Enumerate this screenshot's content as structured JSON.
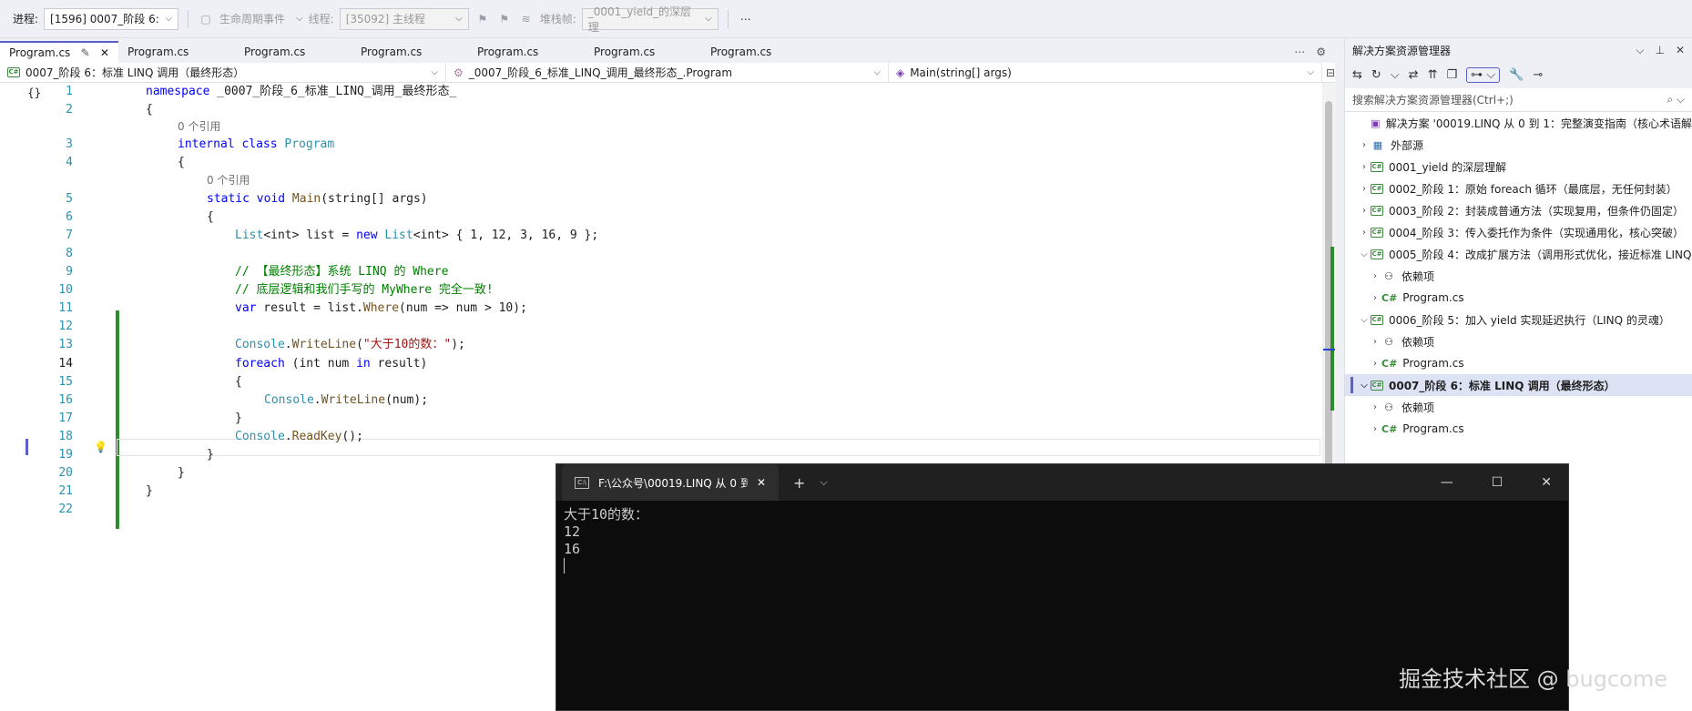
{
  "toolbar": {
    "process_label": "进程:",
    "process_value": "[1596] 0007_阶段 6:",
    "lifecycle_label": "生命周期事件",
    "thread_label": "线程:",
    "thread_value": "[35092] 主线程",
    "stackframe_label": "堆栈帧:",
    "stackframe_value": "_0001_yield_的深层理"
  },
  "tabs": [
    {
      "label": "Program.cs"
    },
    {
      "label": "Program.cs"
    },
    {
      "label": "Program.cs"
    },
    {
      "label": "Program.cs"
    },
    {
      "label": "Program.cs"
    },
    {
      "label": "Program.cs"
    },
    {
      "label": "Program.cs"
    }
  ],
  "navbar": {
    "project": "0007_阶段 6：标准 LINQ 调用（最终形态）",
    "type": "_0007_阶段_6_标准_LINQ_调用_最终形态_.Program",
    "member": "Main(string[] args)"
  },
  "code": {
    "l1_kw": "namespace",
    "l1_name": " _0007_阶段_6_标准_LINQ_调用_最终形态_",
    "l2": "{",
    "ref0": "0 个引用",
    "l3_kw": "internal class",
    "l3_ty": " Program",
    "l4": "{",
    "ref1": "0 个引用",
    "l5_kw": "static void",
    "l5_m": " Main",
    "l5_rest": "(string[] args)",
    "l6": "{",
    "l7_ty": "List",
    "l7_a": "<int> list = ",
    "l7_kw": "new",
    "l7_ty2": " List",
    "l7_b": "<int> { 1, 12, 3, 16, 9 };",
    "l9": "// 【最终形态】系统 LINQ 的 Where",
    "l10": "// 底层逻辑和我们手写的 MyWhere 完全一致!",
    "l11_kw": "var",
    "l11_a": " result = list.",
    "l11_m": "Where",
    "l11_b": "(num => num > 10);",
    "l13_ty": "Console",
    "l13_a": ".",
    "l13_m": "WriteLine",
    "l13_b": "(",
    "l13_str": "\"大于10的数：\"",
    "l13_c": ");",
    "l14_kw": "foreach",
    "l14_a": " (int num ",
    "l14_kw2": "in",
    "l14_b": " result)",
    "l15": "{",
    "l16_ty": "Console",
    "l16_a": ".",
    "l16_m": "WriteLine",
    "l16_b": "(num);",
    "l17": "}",
    "l18_ty": "Console",
    "l18_a": ".",
    "l18_m": "ReadKey",
    "l18_b": "();",
    "l19": "}",
    "l20": "}",
    "l21": "}"
  },
  "line_numbers": [
    "1",
    "2",
    "3",
    "4",
    "5",
    "6",
    "7",
    "8",
    "9",
    "10",
    "11",
    "12",
    "13",
    "14",
    "15",
    "16",
    "17",
    "18",
    "19",
    "20",
    "21",
    "22"
  ],
  "solution": {
    "title": "解决方案资源管理器",
    "search_placeholder": "搜索解决方案资源管理器(Ctrl+;)",
    "root": "解决方案 '00019.LINQ 从 0 到 1：完整演变指南（核心术语解",
    "external": "外部源",
    "p1": "0001_yield 的深层理解",
    "p2": "0002_阶段 1：原始 foreach 循环（最底层，无任何封装）",
    "p3": "0003_阶段 2：封装成普通方法（实现复用，但条件仍固定）",
    "p4": "0004_阶段 3：传入委托作为条件（实现通用化，核心突破）",
    "p5": "0005_阶段 4：改成扩展方法（调用形式优化，接近标准 LINQ",
    "p6": "0006_阶段 5：加入 yield 实现延迟执行（LINQ 的灵魂）",
    "p7": "0007_阶段 6：标准 LINQ 调用（最终形态）",
    "deps": "依赖项",
    "program": "Program.cs"
  },
  "terminal": {
    "title": "F:\\公众号\\00019.LINQ 从 0 到 1",
    "out1": "大于10的数：",
    "out2": "12",
    "out3": "16"
  },
  "watermark": "掘金技术社区 @ bugcome"
}
